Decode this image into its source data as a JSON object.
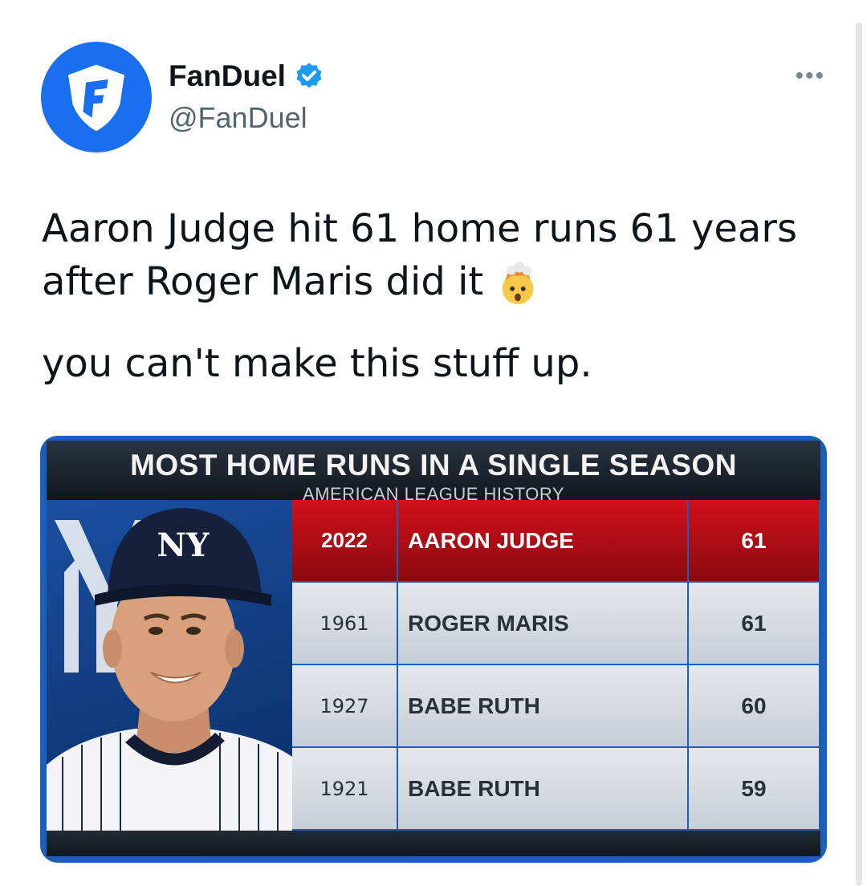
{
  "account": {
    "display_name": "FanDuel",
    "handle": "@FanDuel",
    "verified": true,
    "avatar_icon": "fanduel-shield-logo"
  },
  "menu": {
    "more_label": "•••"
  },
  "tweet": {
    "line1": "Aaron Judge hit 61 home runs 61 years after Roger Maris did it",
    "emoji": "exploding-head",
    "line2": "you can't make this stuff up."
  },
  "graphic": {
    "title": "MOST HOME RUNS IN A SINGLE SEASON",
    "subtitle": "AMERICAN LEAGUE HISTORY",
    "logo_text": "NY",
    "rows": [
      {
        "year": "2022",
        "player": "AARON JUDGE",
        "hr": "61"
      },
      {
        "year": "1961",
        "player": "ROGER MARIS",
        "hr": "61"
      },
      {
        "year": "1927",
        "player": "BABE RUTH",
        "hr": "60"
      },
      {
        "year": "1921",
        "player": "BABE RUTH",
        "hr": "59"
      }
    ]
  },
  "colors": {
    "brand_blue": "#1a6ff0",
    "verified_blue": "#1d9bf0",
    "highlight_red": "#c1121a"
  }
}
